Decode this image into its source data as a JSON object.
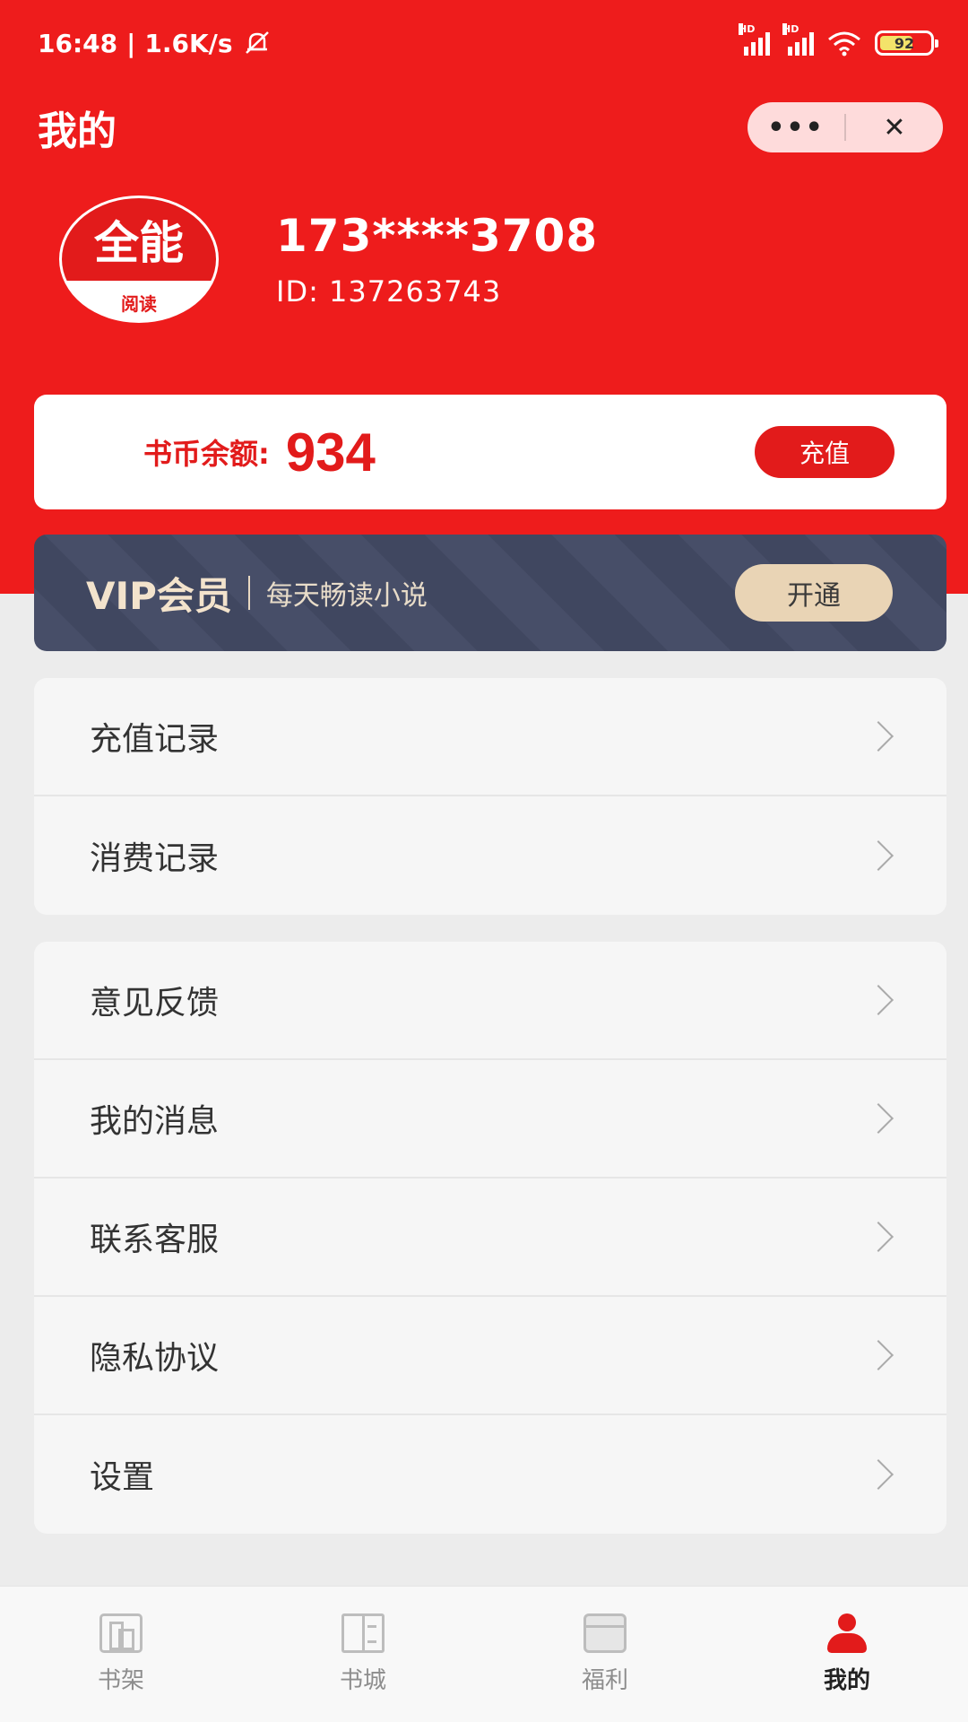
{
  "status_bar": {
    "time": "16:48",
    "speed": "1.6K/s",
    "battery": "92",
    "hd_label": "HD",
    "mute_icon": "bell-off-icon"
  },
  "header": {
    "title": "我的",
    "more_icon": "•••",
    "close_icon": "✕"
  },
  "profile": {
    "avatar_text": "全能",
    "avatar_sub": "阅读",
    "phone": "173****3708",
    "id": "ID: 137263743"
  },
  "coins": {
    "label": "书币余额:",
    "value": "934",
    "recharge_label": "充值"
  },
  "vip": {
    "title": "VIP会员",
    "subtitle": "每天畅读小说",
    "button": "开通"
  },
  "menu_groups": [
    [
      {
        "label": "充值记录"
      },
      {
        "label": "消费记录"
      }
    ],
    [
      {
        "label": "意见反馈"
      },
      {
        "label": "我的消息"
      },
      {
        "label": "联系客服"
      },
      {
        "label": "隐私协议"
      },
      {
        "label": "设置"
      }
    ]
  ],
  "tabs": [
    {
      "label": "书架",
      "icon": "bookshelf-icon"
    },
    {
      "label": "书城",
      "icon": "book-icon"
    },
    {
      "label": "福利",
      "icon": "gift-icon"
    },
    {
      "label": "我的",
      "icon": "person-icon"
    }
  ],
  "colors": {
    "brand_red": "#ee1c1c",
    "vip_bg": "#434a64",
    "vip_gold": "#e9d4b5"
  }
}
